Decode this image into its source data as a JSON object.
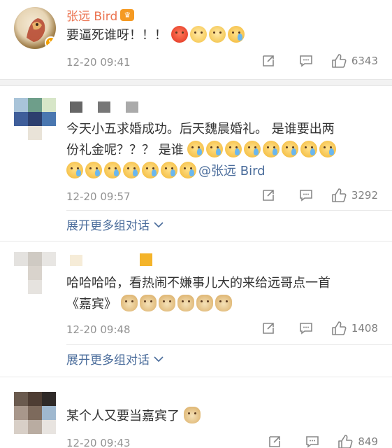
{
  "comments": [
    {
      "user": "张远 Bird",
      "text": "要逼死谁呀！！！",
      "emojis": [
        "angry-face",
        "pout-face",
        "sad-face",
        "crying-face"
      ],
      "time": "12-20 09:41",
      "likes": "6343"
    },
    {
      "text_line1": "今天小五求婚成功。后天魏晨婚礼。 是谁要出两",
      "text_line2": "份礼金呢？？？ 是谁",
      "mention": "@张远 Bird",
      "emojis": [
        "crying-face",
        "crying-face",
        "crying-face",
        "crying-face",
        "crying-face",
        "crying-face",
        "crying-face",
        "crying-face",
        "crying-face",
        "crying-face",
        "crying-face",
        "crying-face",
        "crying-face",
        "crying-face",
        "crying-face"
      ],
      "time": "12-20 09:57",
      "likes": "3292",
      "expand_label": "展开更多组对话"
    },
    {
      "text_line1": "哈哈哈哈，看热闹不嫌事儿大的来给远哥点一首",
      "text_line2": "《嘉宾》",
      "emojis": [
        "doge",
        "doge",
        "doge",
        "doge",
        "doge",
        "doge"
      ],
      "time": "12-20 09:48",
      "likes": "1408",
      "expand_label": "展开更多组对话"
    },
    {
      "text": "某个人又要当嘉宾了",
      "emojis": [
        "doge"
      ],
      "time": "12-20 09:43",
      "likes": "849"
    }
  ],
  "colors": {
    "username": "#eb7350",
    "link": "#4a6c9b",
    "meta": "#939393",
    "verified_badge": "#f3a000"
  }
}
